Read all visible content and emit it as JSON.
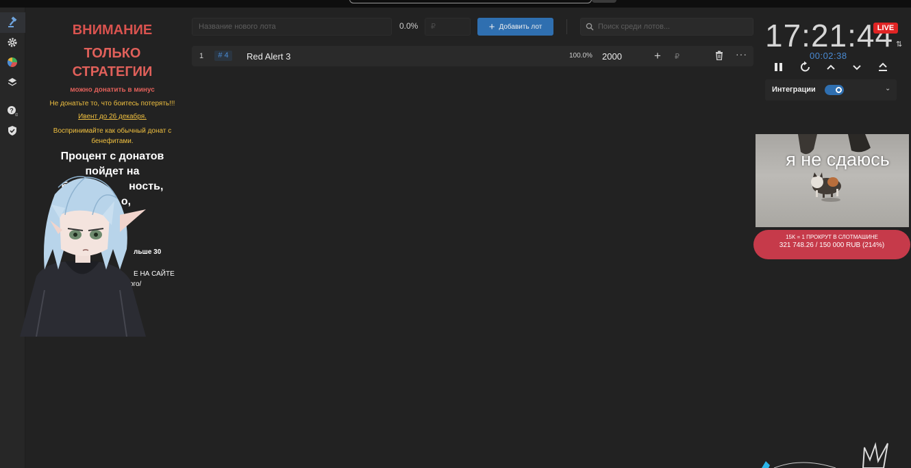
{
  "left_panel": {
    "warning": "ВНИМАНИЕ",
    "strategies_line1": "ТОЛЬКО",
    "strategies_line2": "СТРАТЕГИИ",
    "minus": "можно донатить в минус",
    "donate_note": "Не донатьте то, что боитесь потерять!!!",
    "event_note": "Ивент до 26 декабря.",
    "perceive_line1": "Воспринимайте как обычный донат с",
    "perceive_line2": "бенефитами.",
    "percent_line1": "Процент с донатов",
    "percent_line2": "пойдет на",
    "percent_line3": "бла",
    "percent_line3b": "ность,",
    "percent_line4": "о,",
    "fragment_over30": "льше 30",
    "fragment_site": "Е НА САЙТЕ",
    "fragment_link": "ого/"
  },
  "toolbar": {
    "name_placeholder": "Название нового лота",
    "percent": "0.0%",
    "amount_placeholder": "₽",
    "add_label": "Добавить лот",
    "search_placeholder": "Поиск среди лотов..."
  },
  "lots": [
    {
      "num": "1",
      "id": "# 4",
      "name": "Red Alert 3",
      "percent": "100.0%",
      "amount": "2000",
      "currency": "₽"
    }
  ],
  "right_panel": {
    "clock": "17:21:44",
    "live_badge": "LIVE",
    "swap_icon": "⇅",
    "timer": "00:02:38",
    "integrations_label": "Интеграции",
    "meme_caption": "я не сдаюсь",
    "goal_line1": "15K = 1 ПРОКРУТ В СЛОТМАШИНЕ",
    "goal_line2": "321 748.26 / 150 000 RUB (214%)"
  },
  "colors": {
    "accent": "#2f6fb0",
    "live": "#e02424",
    "goal": "#c63a4a",
    "warning": "#d9534f",
    "yellow_text": "#f0c040"
  },
  "icons": [
    "gavel-icon",
    "gear-icon",
    "pie-chart-icon",
    "layers-icon",
    "help-icon",
    "shield-icon",
    "search-icon",
    "trash-icon",
    "pause-icon",
    "restart-icon",
    "chevron-up-icon",
    "chevron-down-icon",
    "collapse-icon"
  ]
}
